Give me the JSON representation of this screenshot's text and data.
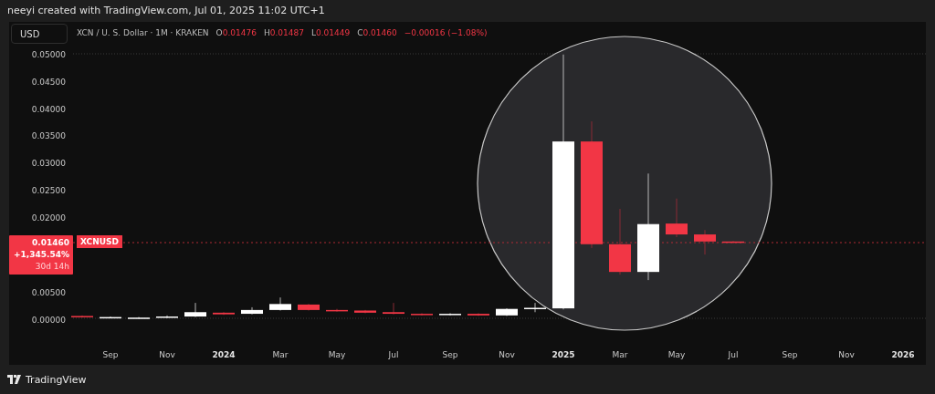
{
  "attribution": "neeyi created with TradingView.com, Jul 01, 2025 11:02 UTC+1",
  "currency_button": "USD",
  "legend": {
    "symbol": "XCN / U. S. Dollar · 1M · KRAKEN",
    "ohlc": [
      {
        "label": "O",
        "value": "0.01476"
      },
      {
        "label": "H",
        "value": "0.01487"
      },
      {
        "label": "L",
        "value": "0.01449"
      },
      {
        "label": "C",
        "value": "0.01460"
      }
    ],
    "change": "−0.00016 (−1.08%)"
  },
  "price_tag": {
    "price": "0.01460",
    "change": "+1,345.54%",
    "countdown": "30d 14h",
    "symbol": "XCNUSD"
  },
  "y_axis": [
    "0.05000",
    "0.04500",
    "0.04000",
    "0.03500",
    "0.03000",
    "0.02500",
    "0.02000",
    "0.00500",
    "0.00000"
  ],
  "x_axis": [
    {
      "label": "Sep",
      "kind": "month"
    },
    {
      "label": "Nov",
      "kind": "month"
    },
    {
      "label": "2024",
      "kind": "year"
    },
    {
      "label": "Mar",
      "kind": "month"
    },
    {
      "label": "May",
      "kind": "month"
    },
    {
      "label": "Jul",
      "kind": "month"
    },
    {
      "label": "Sep",
      "kind": "month"
    },
    {
      "label": "Nov",
      "kind": "month"
    },
    {
      "label": "2025",
      "kind": "year"
    },
    {
      "label": "Mar",
      "kind": "month"
    },
    {
      "label": "May",
      "kind": "month"
    },
    {
      "label": "Jul",
      "kind": "month"
    },
    {
      "label": "Sep",
      "kind": "month"
    },
    {
      "label": "Nov",
      "kind": "month"
    },
    {
      "label": "2026",
      "kind": "year"
    }
  ],
  "footer_logo": "TradingView"
}
